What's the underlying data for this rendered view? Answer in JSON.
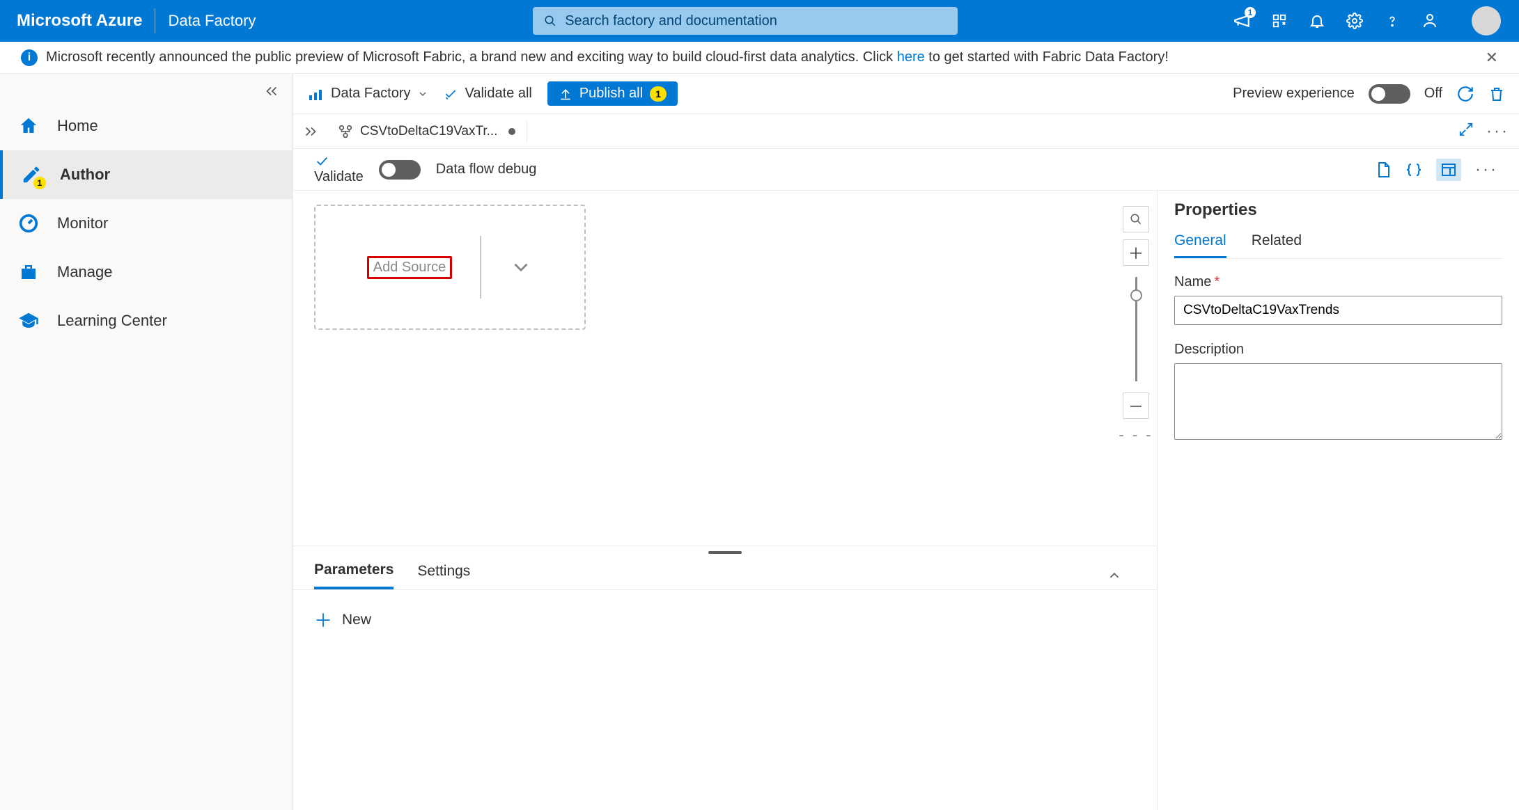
{
  "header": {
    "brand": "Microsoft Azure",
    "service": "Data Factory",
    "search_placeholder": "Search factory and documentation",
    "notif_badge": "1"
  },
  "banner": {
    "text_before_link": "Microsoft recently announced the public preview of Microsoft Fabric, a brand new and exciting way to build cloud-first data analytics. Click ",
    "link_text": "here",
    "text_after_link": " to get started with Fabric Data Factory!"
  },
  "sidebar": {
    "items": [
      {
        "label": "Home"
      },
      {
        "label": "Author",
        "badge": "1"
      },
      {
        "label": "Monitor"
      },
      {
        "label": "Manage"
      },
      {
        "label": "Learning Center"
      }
    ]
  },
  "toolbar": {
    "factory_label": "Data Factory",
    "validate_all": "Validate all",
    "publish_all": "Publish all",
    "publish_count": "1",
    "preview_label": "Preview experience",
    "preview_state": "Off"
  },
  "tabs": {
    "open_tab": "CSVtoDeltaC19VaxTr..."
  },
  "dataflow_toolbar": {
    "validate": "Validate",
    "debug_label": "Data flow debug"
  },
  "canvas": {
    "add_source": "Add Source"
  },
  "properties": {
    "title": "Properties",
    "tabs": {
      "general": "General",
      "related": "Related"
    },
    "name_label": "Name",
    "name_value": "CSVtoDeltaC19VaxTrends",
    "desc_label": "Description",
    "desc_value": ""
  },
  "bottom": {
    "tabs": {
      "parameters_label": "Parameters",
      "settings_label": "Settings"
    },
    "new_label": "New"
  }
}
